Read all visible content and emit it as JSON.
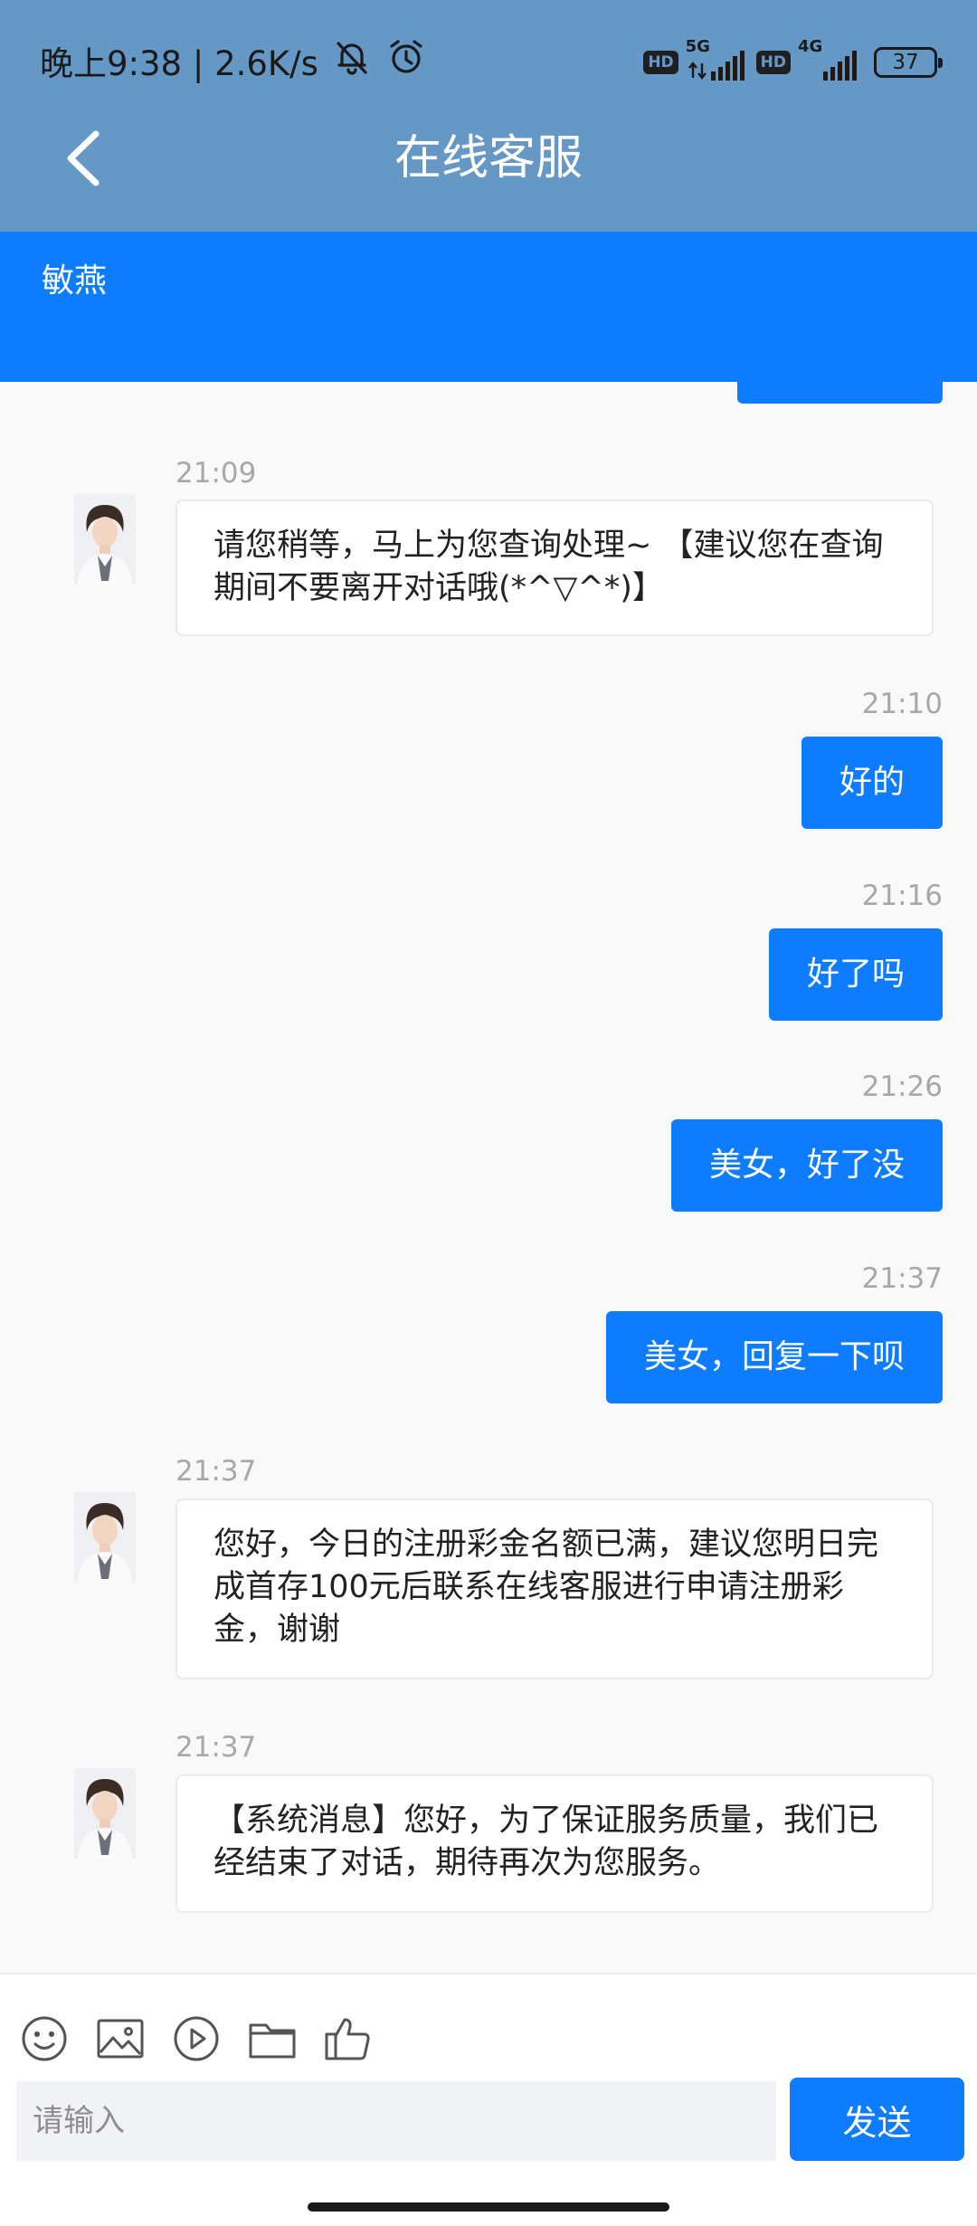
{
  "status_bar": {
    "time_speed": "晚上9:38 | 2.6K/s",
    "icons": [
      "mute-bell-icon",
      "alarm-icon",
      "hd-icon",
      "signal-icon",
      "battery-icon"
    ],
    "hd1": "HD",
    "net1": "5G",
    "hd2": "HD",
    "net2": "4G",
    "battery": "37"
  },
  "header": {
    "title": "在线客服",
    "back_icon": "chevron-left-icon"
  },
  "agent": {
    "name": "敏燕"
  },
  "messages": [
    {
      "side": "left",
      "time": "21:09",
      "text": "请您稍等，马上为您查询处理~ 【建议您在查询期间不要离开对话哦(*^▽^*)】"
    },
    {
      "side": "right",
      "time": "21:10",
      "text": "好的"
    },
    {
      "side": "right",
      "time": "21:16",
      "text": "好了吗"
    },
    {
      "side": "right",
      "time": "21:26",
      "text": "美女，好了没"
    },
    {
      "side": "right",
      "time": "21:37",
      "text": "美女，回复一下呗"
    },
    {
      "side": "left",
      "time": "21:37",
      "text": "您好，今日的注册彩金名额已满，建议您明日完成首存100元后联系在线客服进行申请注册彩金，谢谢"
    },
    {
      "side": "left",
      "time": "21:37",
      "text": "【系统消息】您好，为了保证服务质量，我们已经结束了对话，期待再次为您服务。"
    }
  ],
  "composer": {
    "tools": [
      "emoji-icon",
      "image-icon",
      "video-icon",
      "folder-icon",
      "thumbs-up-icon"
    ],
    "placeholder": "请输入",
    "send_label": "发送"
  },
  "colors": {
    "header_bg": "#6598c5",
    "accent": "#0e7cff",
    "page_bg": "#f9f9f9"
  }
}
